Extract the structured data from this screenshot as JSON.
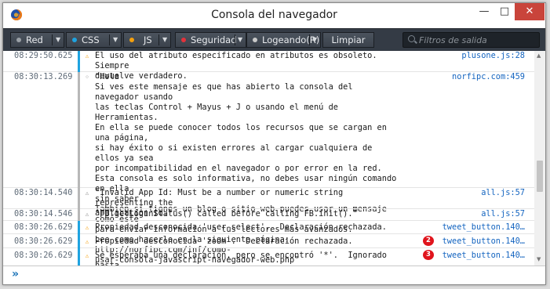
{
  "window": {
    "title": "Consola del navegador",
    "controls": {
      "minimize": "—",
      "maximize": "□",
      "close": "✕"
    }
  },
  "toolbar": {
    "filters": [
      {
        "label": "Red",
        "dot_color": "#9aa0a6"
      },
      {
        "label": "CSS",
        "dot_color": "#1fa3e0"
      },
      {
        "label": "JS",
        "dot_color": "#f5a00d"
      },
      {
        "label": "Seguridad",
        "dot_color": "#e3323b"
      },
      {
        "label": "Logeando(R)",
        "dot_color": "#c9c9c9"
      }
    ],
    "clear_label": "Limpiar",
    "filter_placeholder": "Filtros de salida"
  },
  "log": [
    {
      "time": "08:29:50.625",
      "icon": "warning-icon",
      "category": "css",
      "text": "El uso del atributo especificado en atributos es obsoleto. Siempre\ndevuelve verdadero.",
      "source": "plusone.js:28"
    },
    {
      "time": "08:30:13.269",
      "icon": "log-icon",
      "category": "log",
      "text": "\"Hola\nSi ves este mensaje es que has abierto la consola del navegador usando\nlas teclas Control + Mayus + J o usando el menú de Herramientas.\nEn ella se puede conocer todos los recursos que se cargan en una página,\nsi hay éxito o si existen errores al cargar cualquiera de ellos ya sea\npor incompatibilidad en el navegador o por error en la red.\nEsta consola es solo informativa, no debes usar ningún comando en ella\nsin saber.\nTambién si tienes un blog o sitio web puedes usar un mensaje como este\npara enviar información a tus lectores más avanzados.\nLee como hacerlo en la siguiente página: http://norfipc.com/inf/como-\nusar-consola-javascript-navegador-web.php\"",
      "source": "norfipc.com:459"
    },
    {
      "time": "08:30:14.540",
      "icon": "warning-icon",
      "category": "log",
      "text": "\"Invalid App Id: Must be a number or numeric string representing the\napplication id.\"",
      "source": "all.js:57"
    },
    {
      "time": "08:30:14.546",
      "icon": "warning-icon",
      "category": "log",
      "text": "\"FB.getLoginStatus() called before calling FB.init().\"",
      "source": "all.js:57"
    },
    {
      "time": "08:30:26.629",
      "icon": "warning-icon",
      "category": "css",
      "text": "Propiedad desconocida 'user-select'.  Declaración rechazada.",
      "source": "tweet_button.140…",
      "badge": ""
    },
    {
      "time": "08:30:26.629",
      "icon": "warning-icon",
      "category": "css",
      "text": "Propiedad desconocida 'zoom'.  Declaración rechazada.",
      "source": "tweet_button.140…",
      "badge": "2"
    },
    {
      "time": "08:30:26.629",
      "icon": "warning-icon",
      "category": "css",
      "text": "Se esperaba una declaración, pero se encontró '*'.  Ignorado hasta\nla siguiente declaración.",
      "source": "tweet_button.140…",
      "badge": "3"
    }
  ],
  "input": {
    "prompt": "»"
  },
  "colors": {
    "css_bar": "#1fa3e0",
    "js_bar": "#f5a00d",
    "log_bar": "#b8b8b8",
    "warning": "#f5a00d"
  }
}
